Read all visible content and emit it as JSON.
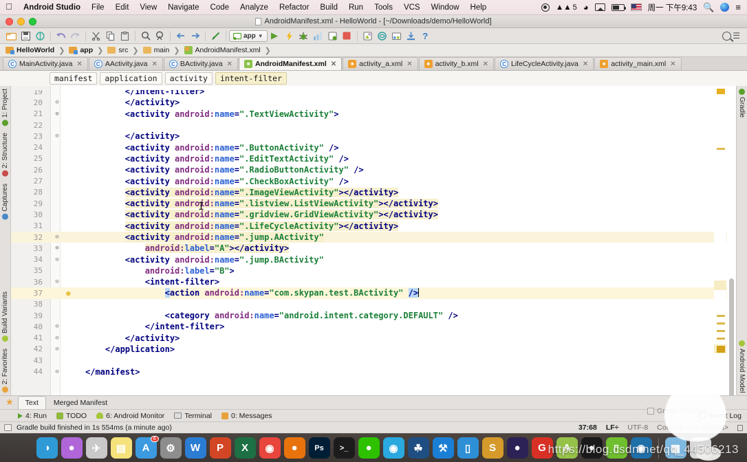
{
  "macbar": {
    "apple": "apple-logo",
    "app_name": "Android Studio",
    "menus": [
      "File",
      "Edit",
      "View",
      "Navigate",
      "Code",
      "Analyze",
      "Refactor",
      "Build",
      "Run",
      "Tools",
      "VCS",
      "Window",
      "Help"
    ],
    "status_count": "5",
    "clock": "周一 下午9:43"
  },
  "window": {
    "title": "AndroidManifest.xml - HelloWorld - [~/Downloads/demo/HelloWorld]",
    "run_config": "app"
  },
  "breadcrumb": {
    "items": [
      "HelloWorld",
      "app",
      "src",
      "main",
      "AndroidManifest.xml"
    ]
  },
  "editor_tabs": [
    {
      "label": "MainActivity.java",
      "icon": "java-class-icon",
      "active": false
    },
    {
      "label": "AActivity.java",
      "icon": "java-class-icon",
      "active": false
    },
    {
      "label": "BActivity.java",
      "icon": "java-class-icon",
      "active": false
    },
    {
      "label": "AndroidManifest.xml",
      "icon": "android-manifest-icon",
      "active": true
    },
    {
      "label": "activity_a.xml",
      "icon": "xml-layout-icon",
      "active": false
    },
    {
      "label": "activity_b.xml",
      "icon": "xml-layout-icon",
      "active": false
    },
    {
      "label": "LifeCycleActivity.java",
      "icon": "java-class-icon",
      "active": false
    },
    {
      "label": "activity_main.xml",
      "icon": "xml-layout-icon",
      "active": false
    }
  ],
  "xml_breadcrumb": [
    "manifest",
    "application",
    "activity",
    "intent-filter"
  ],
  "code": {
    "first_line_number": 19,
    "caret_line": 37,
    "lines": [
      {
        "n": 19,
        "indent": 8,
        "clipped": true,
        "segs": [
          {
            "t": "</intent-filter>",
            "c": "tag"
          }
        ]
      },
      {
        "n": 20,
        "fold": "minus",
        "indent": 8,
        "segs": [
          {
            "t": "</activity>",
            "c": "tag"
          }
        ]
      },
      {
        "n": 21,
        "fold": "plus",
        "indent": 8,
        "segs": [
          {
            "t": "<activity ",
            "c": "tag"
          },
          {
            "t": "android:",
            "c": "attr"
          },
          {
            "t": "name",
            "c": "aname"
          },
          {
            "t": "=",
            "c": "pun"
          },
          {
            "t": "\".TextViewActivity\"",
            "c": "val"
          },
          {
            "t": ">",
            "c": "tag"
          }
        ]
      },
      {
        "n": 22,
        "indent": 0,
        "segs": []
      },
      {
        "n": 23,
        "fold": "minus",
        "indent": 8,
        "segs": [
          {
            "t": "</activity>",
            "c": "tag"
          }
        ]
      },
      {
        "n": 24,
        "indent": 8,
        "segs": [
          {
            "t": "<activity ",
            "c": "tag"
          },
          {
            "t": "android:",
            "c": "attr"
          },
          {
            "t": "name",
            "c": "aname"
          },
          {
            "t": "=",
            "c": "pun"
          },
          {
            "t": "\".ButtonActivity\"",
            "c": "val"
          },
          {
            "t": " />",
            "c": "tag"
          }
        ]
      },
      {
        "n": 25,
        "indent": 8,
        "segs": [
          {
            "t": "<activity ",
            "c": "tag"
          },
          {
            "t": "android:",
            "c": "attr"
          },
          {
            "t": "name",
            "c": "aname"
          },
          {
            "t": "=",
            "c": "pun"
          },
          {
            "t": "\".EditTextActivity\"",
            "c": "val"
          },
          {
            "t": " />",
            "c": "tag"
          }
        ]
      },
      {
        "n": 26,
        "indent": 8,
        "segs": [
          {
            "t": "<activity ",
            "c": "tag"
          },
          {
            "t": "android:",
            "c": "attr"
          },
          {
            "t": "name",
            "c": "aname"
          },
          {
            "t": "=",
            "c": "pun"
          },
          {
            "t": "\".RadioButtonActivity\"",
            "c": "val"
          },
          {
            "t": " />",
            "c": "tag"
          }
        ]
      },
      {
        "n": 27,
        "indent": 8,
        "segs": [
          {
            "t": "<activity ",
            "c": "tag"
          },
          {
            "t": "android:",
            "c": "attr"
          },
          {
            "t": "name",
            "c": "aname"
          },
          {
            "t": "=",
            "c": "pun"
          },
          {
            "t": "\".CheckBoxActivity\"",
            "c": "val"
          },
          {
            "t": " />",
            "c": "tag"
          }
        ]
      },
      {
        "n": 28,
        "indent": 8,
        "hl": true,
        "segs": [
          {
            "t": "<activity ",
            "c": "tag"
          },
          {
            "t": "android:",
            "c": "attr"
          },
          {
            "t": "name",
            "c": "aname"
          },
          {
            "t": "=",
            "c": "pun"
          },
          {
            "t": "\".ImageViewActivity\"",
            "c": "val"
          },
          {
            "t": "></activity>",
            "c": "tag"
          }
        ]
      },
      {
        "n": 29,
        "indent": 8,
        "hl": true,
        "segs": [
          {
            "t": "<activity ",
            "c": "tag"
          },
          {
            "t": "android:",
            "c": "attr"
          },
          {
            "t": "name",
            "c": "aname"
          },
          {
            "t": "=",
            "c": "pun"
          },
          {
            "t": "\".listview.ListViewActivity\"",
            "c": "val"
          },
          {
            "t": "></activity>",
            "c": "tag"
          }
        ]
      },
      {
        "n": 30,
        "indent": 8,
        "hl": true,
        "segs": [
          {
            "t": "<activity ",
            "c": "tag"
          },
          {
            "t": "android:",
            "c": "attr"
          },
          {
            "t": "name",
            "c": "aname"
          },
          {
            "t": "=",
            "c": "pun"
          },
          {
            "t": "\".gridview.GridViewActivity\"",
            "c": "val"
          },
          {
            "t": "></activity>",
            "c": "tag"
          }
        ]
      },
      {
        "n": 31,
        "indent": 8,
        "hl": true,
        "segs": [
          {
            "t": "<activity ",
            "c": "tag"
          },
          {
            "t": "android:",
            "c": "attr"
          },
          {
            "t": "name",
            "c": "aname"
          },
          {
            "t": "=",
            "c": "pun"
          },
          {
            "t": "\".LifeCycleActivity\"",
            "c": "val"
          },
          {
            "t": "></activity>",
            "c": "tag"
          }
        ]
      },
      {
        "n": 32,
        "fold": "minus",
        "indent": 8,
        "hl": true,
        "hlfull": true,
        "segs": [
          {
            "t": "<activity ",
            "c": "tag"
          },
          {
            "t": "android:",
            "c": "attr"
          },
          {
            "t": "name",
            "c": "aname"
          },
          {
            "t": "=",
            "c": "pun"
          },
          {
            "t": "\".jump.AActivity\"",
            "c": "val"
          }
        ]
      },
      {
        "n": 33,
        "fold": "plus",
        "indent": 12,
        "hl": true,
        "segs": [
          {
            "t": "android:",
            "c": "attr"
          },
          {
            "t": "label",
            "c": "aname"
          },
          {
            "t": "=",
            "c": "pun"
          },
          {
            "t": "\"A\"",
            "c": "val"
          },
          {
            "t": "></activity>",
            "c": "tag"
          }
        ]
      },
      {
        "n": 34,
        "fold": "minus",
        "indent": 8,
        "segs": [
          {
            "t": "<activity ",
            "c": "tag"
          },
          {
            "t": "android:",
            "c": "attr"
          },
          {
            "t": "name",
            "c": "aname"
          },
          {
            "t": "=",
            "c": "pun"
          },
          {
            "t": "\".jump.BActivity\"",
            "c": "val"
          }
        ]
      },
      {
        "n": 35,
        "indent": 12,
        "segs": [
          {
            "t": "android:",
            "c": "attr"
          },
          {
            "t": "label",
            "c": "aname"
          },
          {
            "t": "=",
            "c": "pun"
          },
          {
            "t": "\"B\"",
            "c": "val"
          },
          {
            "t": ">",
            "c": "tag"
          }
        ]
      },
      {
        "n": 36,
        "fold": "minus",
        "indent": 12,
        "segs": [
          {
            "t": "<intent-filter>",
            "c": "tag"
          }
        ]
      },
      {
        "n": 37,
        "indent": 16,
        "bulb": true,
        "caret": true,
        "segs": [
          {
            "t": "<",
            "c": "tag",
            "brk": true
          },
          {
            "t": "action ",
            "c": "tag"
          },
          {
            "t": "android:",
            "c": "attr"
          },
          {
            "t": "name",
            "c": "aname"
          },
          {
            "t": "=",
            "c": "pun"
          },
          {
            "t": "\"com.skypan.test.BActivity\"",
            "c": "val"
          },
          {
            "t": " ",
            "c": "tag"
          },
          {
            "t": "/>",
            "c": "tag",
            "brk": true
          }
        ]
      },
      {
        "n": 38,
        "indent": 0,
        "segs": []
      },
      {
        "n": 39,
        "indent": 16,
        "segs": [
          {
            "t": "<category ",
            "c": "tag"
          },
          {
            "t": "android:",
            "c": "attr"
          },
          {
            "t": "name",
            "c": "aname"
          },
          {
            "t": "=",
            "c": "pun"
          },
          {
            "t": "\"android.intent.category.DEFAULT\"",
            "c": "val"
          },
          {
            "t": " />",
            "c": "tag"
          }
        ]
      },
      {
        "n": 40,
        "fold": "minus",
        "indent": 12,
        "segs": [
          {
            "t": "</intent-filter>",
            "c": "tag"
          }
        ]
      },
      {
        "n": 41,
        "fold": "minus",
        "indent": 8,
        "segs": [
          {
            "t": "</activity>",
            "c": "tag"
          }
        ]
      },
      {
        "n": 42,
        "fold": "minus",
        "indent": 4,
        "segs": [
          {
            "t": "</application>",
            "c": "tag"
          }
        ]
      },
      {
        "n": 43,
        "indent": 0,
        "segs": []
      },
      {
        "n": 44,
        "fold": "minus",
        "indent": 0,
        "segs": [
          {
            "t": "</manifest>",
            "c": "tag"
          }
        ]
      }
    ]
  },
  "left_toolwindows": [
    {
      "label": "1: Project",
      "icon": "project-icon"
    },
    {
      "label": "2: Structure",
      "icon": "structure-icon"
    },
    {
      "label": "Captures",
      "icon": "captures-icon"
    },
    {
      "label": "Build Variants",
      "icon": "build-variants-icon"
    },
    {
      "label": "2: Favorites",
      "icon": "favorites-icon"
    }
  ],
  "right_toolwindows": [
    {
      "label": "Gradle",
      "icon": "gradle-icon"
    },
    {
      "label": "Android Model",
      "icon": "android-model-icon"
    }
  ],
  "editor_footer_tabs": [
    {
      "label": "Text",
      "active": true
    },
    {
      "label": "Merged Manifest",
      "active": false
    }
  ],
  "bottom_tools": [
    {
      "label": "4: Run",
      "mnemonic": "4",
      "icon": "run-icon"
    },
    {
      "label": "TODO",
      "mnemonic": "",
      "icon": "todo-icon"
    },
    {
      "label": "6: Android Monitor",
      "mnemonic": "6",
      "icon": "android-monitor-icon"
    },
    {
      "label": "Terminal",
      "mnemonic": "",
      "icon": "terminal-icon"
    },
    {
      "label": "0: Messages",
      "mnemonic": "0",
      "icon": "messages-icon"
    }
  ],
  "event_log_label": "Event Log",
  "gradle_console_label": "Gradle Console",
  "statusbar": {
    "message": "Gradle build finished in 1s 554ms (a minute ago)",
    "position": "37:68",
    "line_sep": "LF÷",
    "encoding": "UTF-8",
    "context_label": "Context:",
    "context_value": "<no context>"
  },
  "dock": [
    {
      "name": "finder",
      "glyph": "◑",
      "color": "#2e9bd6"
    },
    {
      "name": "siri",
      "glyph": "●",
      "color": "#b066d9"
    },
    {
      "name": "launchpad",
      "glyph": "✈",
      "color": "#c9c9c9"
    },
    {
      "name": "notes",
      "glyph": "▤",
      "color": "#f5e27a"
    },
    {
      "name": "app-store",
      "glyph": "A",
      "color": "#3b9ae0",
      "badge": "6"
    },
    {
      "name": "system-preferences",
      "glyph": "⚙",
      "color": "#8d8d8d"
    },
    {
      "name": "word",
      "glyph": "W",
      "color": "#2b7cd3"
    },
    {
      "name": "powerpoint",
      "glyph": "P",
      "color": "#d24625"
    },
    {
      "name": "excel",
      "glyph": "X",
      "color": "#1d7044"
    },
    {
      "name": "chrome",
      "glyph": "◉",
      "color": "#e8453c"
    },
    {
      "name": "firefox",
      "glyph": "●",
      "color": "#e8730c"
    },
    {
      "name": "photoshop",
      "glyph": "Ps",
      "color": "#001e36"
    },
    {
      "name": "iterm",
      "glyph": ">_",
      "color": "#1c1c1c"
    },
    {
      "name": "wechat",
      "glyph": "●",
      "color": "#2dc100"
    },
    {
      "name": "safari",
      "glyph": "◉",
      "color": "#2aa9e0"
    },
    {
      "name": "sourcetree",
      "glyph": "☘",
      "color": "#1f4f82"
    },
    {
      "name": "xcode",
      "glyph": "⚒",
      "color": "#1a7fd4"
    },
    {
      "name": "simulator",
      "glyph": "▯",
      "color": "#2e8fd6"
    },
    {
      "name": "sublime-text",
      "glyph": "S",
      "color": "#d59a2a"
    },
    {
      "name": "eclipse",
      "glyph": "●",
      "color": "#2c2255"
    },
    {
      "name": "gmail",
      "glyph": "G",
      "color": "#d93025"
    },
    {
      "name": "android-studio",
      "glyph": "A",
      "color": "#97c24a"
    },
    {
      "name": "qq",
      "glyph": "●",
      "color": "#1a1a1a"
    },
    {
      "name": "genymotion",
      "glyph": "▯",
      "color": "#6fbf2e"
    },
    {
      "name": "quicktime",
      "glyph": "◉",
      "color": "#1f6fa8"
    },
    {
      "name": "downloads-stack",
      "glyph": "▦",
      "color": "#7fb9e0"
    },
    {
      "name": "trash",
      "glyph": "□",
      "color": "#d8d8d8"
    }
  ],
  "watermark": "https://blog.csdn.net/qq_44506213"
}
